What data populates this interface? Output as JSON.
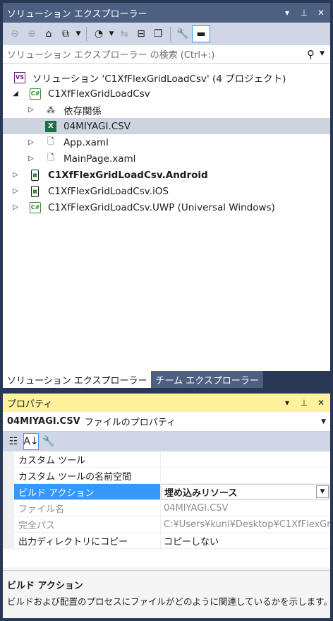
{
  "solution_explorer": {
    "title": "ソリューション エクスプローラー",
    "title_icons": [
      "dropdown-icon",
      "pin-icon",
      "close-icon"
    ],
    "search_placeholder": "ソリューション エクスプローラー の検索 (Ctrl+:)",
    "tree": {
      "solution": "ソリューション 'C1XfFlexGridLoadCsv' (4 プロジェクト)",
      "project_shared": "C1XfFlexGridLoadCsv",
      "dependencies": "依存関係",
      "csv_file": "04MIYAGI.CSV",
      "app_xaml": "App.xaml",
      "mainpage_xaml": "MainPage.xaml",
      "project_android": "C1XfFlexGridLoadCsv.Android",
      "project_ios": "C1XfFlexGridLoadCsv.iOS",
      "project_uwp": "C1XfFlexGridLoadCsv.UWP (Universal Windows)"
    },
    "tabs": [
      {
        "label": "ソリューション エクスプローラー",
        "active": true
      },
      {
        "label": "チーム エクスプローラー",
        "active": false
      }
    ]
  },
  "properties": {
    "title": "プロパティ",
    "object_name": "04MIYAGI.CSV",
    "object_type": "ファイルのプロパティ",
    "rows": [
      {
        "name": "カスタム ツール",
        "value": ""
      },
      {
        "name": "カスタム ツールの名前空間",
        "value": ""
      },
      {
        "name": "ビルド アクション",
        "value": "埋め込みリソース"
      },
      {
        "name": "ファイル名",
        "value": "04MIYAGI.CSV"
      },
      {
        "name": "完全パス",
        "value": "C:¥Users¥kuni¥Desktop¥C1XfFlexGr"
      },
      {
        "name": "出力ディレクトリにコピー",
        "value": "コピーしない"
      }
    ],
    "description_title": "ビルド アクション",
    "description_text": "ビルドおよび配置のプロセスにファイルがどのように関連しているかを示します。"
  },
  "colors": {
    "background": "#293955",
    "title_inactive": "#4d6082",
    "title_active": "#fff29d",
    "selection": "#3399ff"
  }
}
